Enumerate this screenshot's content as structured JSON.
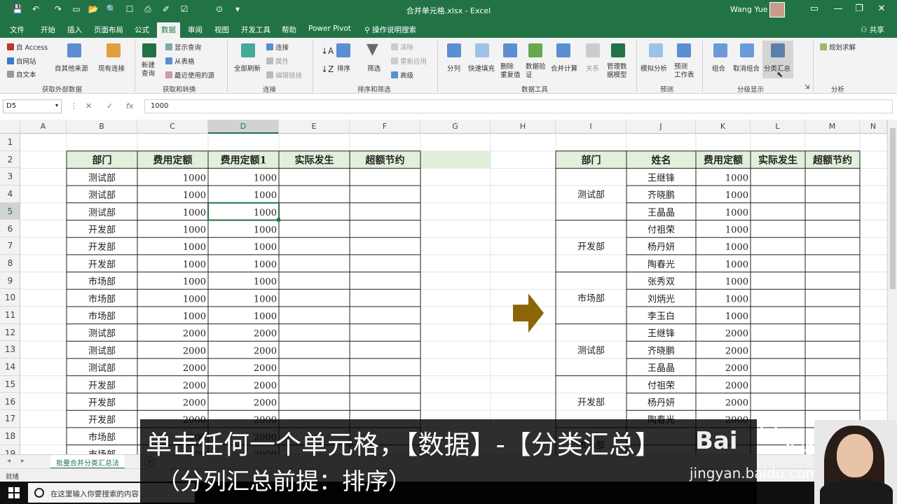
{
  "titlebar": {
    "title": "合并单元格.xlsx  -  Excel",
    "user": "Wang Yue",
    "quick_access": [
      "💾",
      "↶",
      "↷",
      "▭",
      "📂",
      "🔍",
      "☐",
      "⎙",
      "✐",
      "☑",
      "⊙",
      "▾"
    ]
  },
  "tabs": [
    "文件",
    "开始",
    "插入",
    "页面布局",
    "公式",
    "数据",
    "审阅",
    "视图",
    "开发工具",
    "帮助",
    "Power Pivot",
    "操作说明搜索"
  ],
  "active_tab": "数据",
  "share_label": "共享",
  "ribbon": {
    "get_external": {
      "access": "自 Access",
      "web": "自网站",
      "text": "自文本",
      "other": "自其他来源",
      "existing": "现有连接",
      "group": "获取外部数据"
    },
    "transform": {
      "new_query": "新建\n查询",
      "show_query": "显示查询",
      "from_table": "从表格",
      "recent": "最近使用的源",
      "group": "获取和转换"
    },
    "connections": {
      "refresh": "全部刷新",
      "connections": "连接",
      "properties": "属性",
      "edit_links": "编辑链接",
      "group": "连接"
    },
    "sort_filter": {
      "sort": "排序",
      "filter": "筛选",
      "clear": "清除",
      "reapply": "重新应用",
      "advanced": "高级",
      "group": "排序和筛选"
    },
    "data_tools": {
      "split": "分列",
      "flash_fill": "快速填充",
      "remove_dup": "删除\n重复值",
      "validation": "数据验\n证",
      "consolidate": "合并计算",
      "relations": "关系",
      "data_model": "管理数\n据模型",
      "group": "数据工具"
    },
    "forecast": {
      "what_if": "模拟分析",
      "forecast_sheet": "预测\n工作表",
      "group": "预测"
    },
    "outline": {
      "group_btn": "组合",
      "ungroup": "取消组合",
      "subtotal": "分类汇总",
      "group": "分级显示"
    },
    "analysis": {
      "solver": "规划求解",
      "group": "分析"
    }
  },
  "formula_bar": {
    "name_box": "D5",
    "cancel": "✕",
    "enter": "✓",
    "fx": "fx",
    "value": "1000"
  },
  "columns": [
    "A",
    "B",
    "C",
    "D",
    "E",
    "F",
    "G",
    "H",
    "I",
    "J",
    "K",
    "L",
    "M",
    "N"
  ],
  "rows": [
    "1",
    "2",
    "3",
    "4",
    "5",
    "6",
    "7",
    "8",
    "9",
    "10",
    "11",
    "12",
    "13",
    "14",
    "15",
    "16",
    "17",
    "18",
    "19"
  ],
  "selected_cell": "D5",
  "left_table": {
    "headers": [
      "部门",
      "费用定额",
      "费用定额1",
      "实际发生",
      "超额节约"
    ],
    "rows": [
      [
        "测试部",
        "1000",
        "1000"
      ],
      [
        "测试部",
        "1000",
        "1000"
      ],
      [
        "测试部",
        "1000",
        "1000"
      ],
      [
        "开发部",
        "1000",
        "1000"
      ],
      [
        "开发部",
        "1000",
        "1000"
      ],
      [
        "开发部",
        "1000",
        "1000"
      ],
      [
        "市场部",
        "1000",
        "1000"
      ],
      [
        "市场部",
        "1000",
        "1000"
      ],
      [
        "市场部",
        "1000",
        "1000"
      ],
      [
        "测试部",
        "2000",
        "2000"
      ],
      [
        "测试部",
        "2000",
        "2000"
      ],
      [
        "测试部",
        "2000",
        "2000"
      ],
      [
        "开发部",
        "2000",
        "2000"
      ],
      [
        "开发部",
        "2000",
        "2000"
      ],
      [
        "开发部",
        "2000",
        "2000"
      ],
      [
        "市场部",
        "2000",
        "2000"
      ],
      [
        "市场部",
        "2000",
        "2000"
      ]
    ]
  },
  "right_table": {
    "headers": [
      "部门",
      "姓名",
      "费用定额",
      "实际发生",
      "超额节约"
    ],
    "groups": [
      {
        "dept": "测试部",
        "span": 3
      },
      {
        "dept": "开发部",
        "span": 3
      },
      {
        "dept": "市场部",
        "span": 3
      },
      {
        "dept": "测试部",
        "span": 3
      },
      {
        "dept": "开发部",
        "span": 3
      },
      {
        "dept": "市场部",
        "span": 2
      }
    ],
    "rows": [
      [
        "王继锋",
        "1000"
      ],
      [
        "齐晓鹏",
        "1000"
      ],
      [
        "王晶晶",
        "1000"
      ],
      [
        "付祖荣",
        "1000"
      ],
      [
        "杨丹妍",
        "1000"
      ],
      [
        "陶春光",
        "1000"
      ],
      [
        "张秀双",
        "1000"
      ],
      [
        "刘炳光",
        "1000"
      ],
      [
        "李玉白",
        "1000"
      ],
      [
        "王继锋",
        "2000"
      ],
      [
        "齐晓鹏",
        "2000"
      ],
      [
        "王晶晶",
        "2000"
      ],
      [
        "付祖荣",
        "2000"
      ],
      [
        "杨丹妍",
        "2000"
      ],
      [
        "陶春光",
        "2000"
      ]
    ]
  },
  "sheet_tab": "批量合并分类汇总法",
  "status": "就绪",
  "taskbar_search": "在这里输入你要搜索的内容",
  "subtitle": {
    "line1": "单击任何一个单元格，【数据】-【分类汇总】",
    "line2": "（分列汇总前提：排序）"
  },
  "watermark": {
    "logo": "Bai",
    "logo2": "经验",
    "url": "jingyan.baidu.com"
  },
  "colors": {
    "excel_green": "#217346",
    "header_fill": "#e2efda",
    "arrow": "#8b6508"
  }
}
